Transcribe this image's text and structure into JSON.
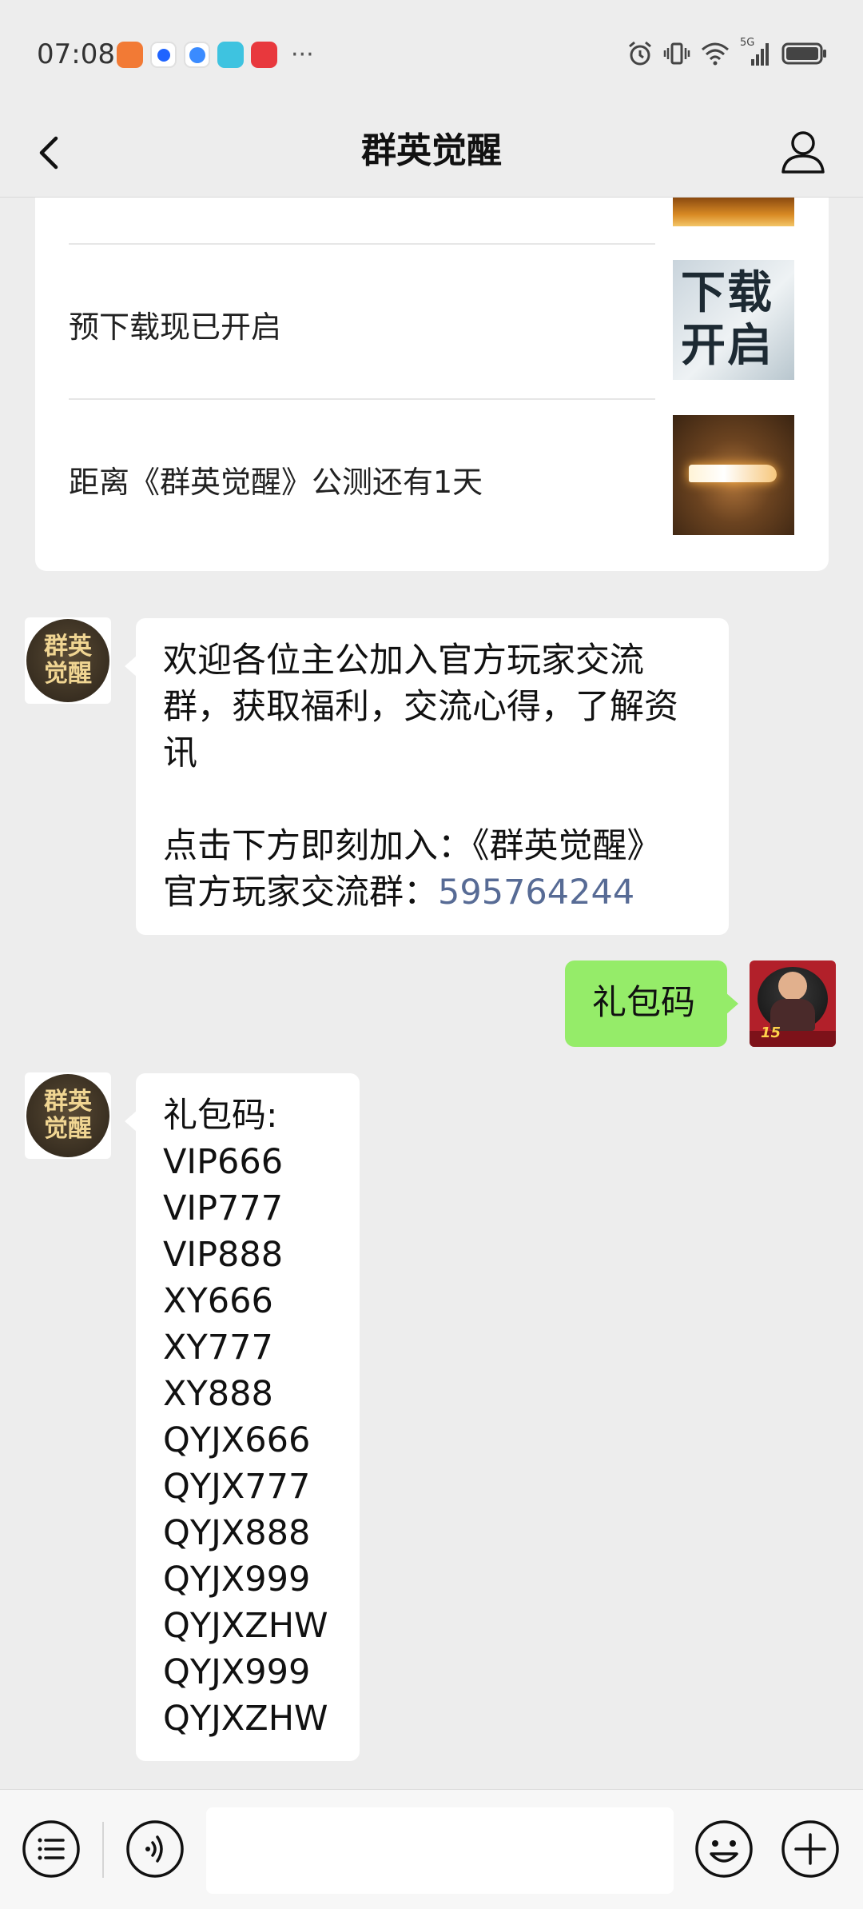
{
  "status": {
    "time": "07:08",
    "more": "···",
    "network": "5G"
  },
  "nav": {
    "title": "群英觉醒"
  },
  "articles": [
    {
      "title": "预下载现已开启",
      "thumb_text": "下载开启"
    },
    {
      "title": "距离《群英觉醒》公测还有1天"
    }
  ],
  "messages": {
    "welcome": {
      "lines": [
        "欢迎各位主公加入官方玩家交流",
        "群，获取福利，交流心得，了解资",
        "讯"
      ],
      "lines2": [
        "点击下方即刻加入：《群英觉醒》"
      ],
      "group_prefix": "官方玩家交流群：",
      "group_number": "595764244"
    },
    "user": {
      "text": "礼包码"
    },
    "codes": {
      "header": "礼包码:",
      "items": [
        "VIP666",
        "VIP777",
        "VIP888",
        "XY666",
        "XY777",
        "XY888",
        "QYJX666",
        "QYJX777",
        "QYJX888",
        "QYJX999",
        "QYJXZHW",
        "QYJX999",
        "QYJXZHW"
      ]
    }
  },
  "colors": {
    "background": "#ededed",
    "bubble_in": "#ffffff",
    "bubble_out": "#95ec69",
    "link": "#576b95"
  },
  "icons": {
    "back": "chevron-left-icon",
    "profile": "person-icon",
    "menu": "list-menu-icon",
    "voice": "voice-icon",
    "emoji": "emoji-icon",
    "more": "plus-icon"
  }
}
